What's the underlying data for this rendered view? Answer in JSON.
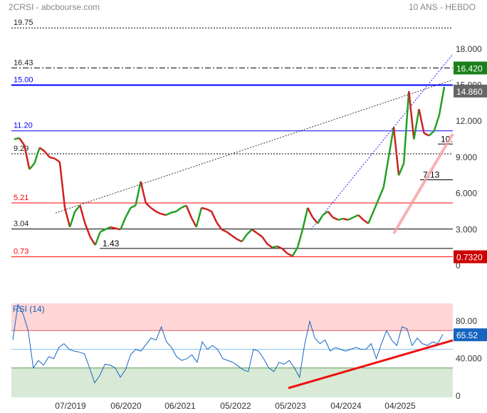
{
  "header": {
    "title": "2CRSI - abcbourse.com",
    "period": "10 ANS - HEBDO"
  },
  "chart_data": [
    {
      "type": "line",
      "title": "2CRSI",
      "ylim": [
        0,
        18
      ],
      "yticks": [
        "18.000",
        "15.000",
        "12.000",
        "9.000",
        "6.000",
        "3.000",
        "0"
      ],
      "yticks_values": [
        18,
        15,
        12,
        9,
        6,
        3,
        0
      ],
      "price_series": [
        10.5,
        10.6,
        10.0,
        8.0,
        8.5,
        9.8,
        9.5,
        9.0,
        8.9,
        8.6,
        4.8,
        3.2,
        4.5,
        5.0,
        3.5,
        2.4,
        1.7,
        2.8,
        3.0,
        3.2,
        3.1,
        3.0,
        4.0,
        4.8,
        5.0,
        7.0,
        5.2,
        4.8,
        4.5,
        4.3,
        4.2,
        4.4,
        4.5,
        4.8,
        5.0,
        4.0,
        3.2,
        4.8,
        4.7,
        4.5,
        3.6,
        3.0,
        2.8,
        2.5,
        2.2,
        2.0,
        2.6,
        3.0,
        2.7,
        2.4,
        1.8,
        1.5,
        1.6,
        1.4,
        1.0,
        0.8,
        1.5,
        3.0,
        4.8,
        4.0,
        3.5,
        4.2,
        4.5,
        4.0,
        3.8,
        3.9,
        3.8,
        4.0,
        4.2,
        3.8,
        3.5,
        4.5,
        5.5,
        6.5,
        9.0,
        11.5,
        7.5,
        8.5,
        14.5,
        10.5,
        13.0,
        11.0,
        10.8,
        11.2,
        12.5,
        14.86
      ],
      "levels": [
        {
          "label": "19.75",
          "value": 19.75,
          "color": "#000000",
          "style": "dotted"
        },
        {
          "label": "16.43",
          "value": 16.43,
          "color": "#000000",
          "style": "dashdot"
        },
        {
          "label": "15.00",
          "value": 15.0,
          "color": "#0000ff",
          "style": "solid-thick"
        },
        {
          "label": "11.20",
          "value": 11.2,
          "color": "#0000ff",
          "style": "solid"
        },
        {
          "label": "9.29",
          "value": 9.29,
          "color": "#000000",
          "style": "dotted"
        },
        {
          "label": "5.21",
          "value": 5.21,
          "color": "#ff0000",
          "style": "solid"
        },
        {
          "label": "3.04",
          "value": 3.04,
          "color": "#000000",
          "style": "solid"
        },
        {
          "label": "0.73",
          "value": 0.73,
          "color": "#ff0000",
          "style": "solid"
        }
      ],
      "short_levels": [
        {
          "label": "1.43",
          "value": 1.43
        },
        {
          "label": "7.13",
          "value": 7.13
        },
        {
          "label": "10.",
          "value": 10.1
        }
      ],
      "badges": [
        {
          "label": "16.420",
          "color": "#1a7f1a"
        },
        {
          "label": "14.860",
          "color": "#666666"
        },
        {
          "label": "0.7320",
          "color": "#cc0000"
        }
      ],
      "xticks": [
        "07/2019",
        "06/2020",
        "06/2021",
        "05/2022",
        "05/2023",
        "04/2024",
        "04/2025"
      ]
    },
    {
      "type": "line",
      "title": "RSI (14)",
      "ylim": [
        0,
        100
      ],
      "yticks": [
        "80.00",
        "40.000",
        "0"
      ],
      "yticks_values": [
        80,
        40,
        0
      ],
      "zones": {
        "overbought": 70,
        "mid": 50,
        "oversold": 30
      },
      "current": "65.52",
      "current_color": "#1565c0",
      "rsi_series": [
        60,
        98,
        88,
        70,
        30,
        38,
        33,
        42,
        40,
        52,
        56,
        50,
        48,
        47,
        45,
        30,
        14,
        22,
        34,
        33,
        30,
        20,
        28,
        44,
        50,
        48,
        55,
        62,
        60,
        74,
        58,
        52,
        42,
        38,
        40,
        44,
        36,
        58,
        50,
        54,
        50,
        40,
        38,
        36,
        32,
        28,
        26,
        50,
        48,
        40,
        30,
        26,
        36,
        34,
        38,
        30,
        20,
        55,
        80,
        62,
        56,
        60,
        48,
        52,
        50,
        48,
        50,
        52,
        50,
        50,
        56,
        40,
        56,
        70,
        60,
        54,
        74,
        72,
        54,
        62,
        56,
        54,
        58,
        56,
        66
      ]
    }
  ]
}
